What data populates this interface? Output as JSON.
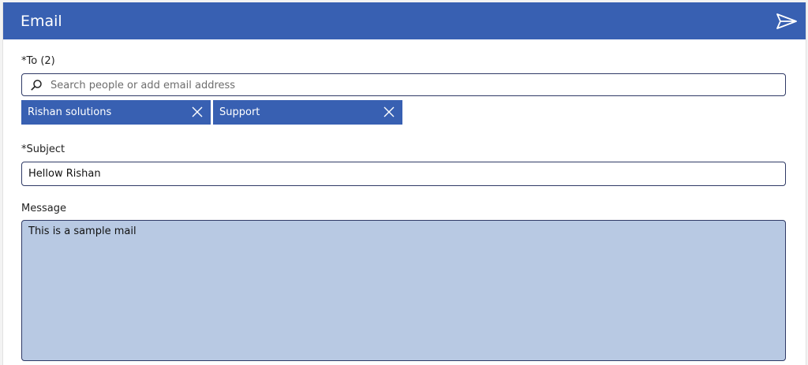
{
  "header": {
    "title": "Email",
    "send_icon": "send-icon"
  },
  "to": {
    "label": "*To (2)",
    "search_placeholder": "Search people or add email address",
    "recipients": [
      {
        "name": "Rishan solutions"
      },
      {
        "name": "Support"
      }
    ]
  },
  "subject": {
    "label": "*Subject",
    "value": "Hellow Rishan"
  },
  "message": {
    "label": "Message",
    "value": "This is a sample mail"
  },
  "colors": {
    "accent": "#3860b2",
    "message_bg": "#b8c9e3"
  }
}
